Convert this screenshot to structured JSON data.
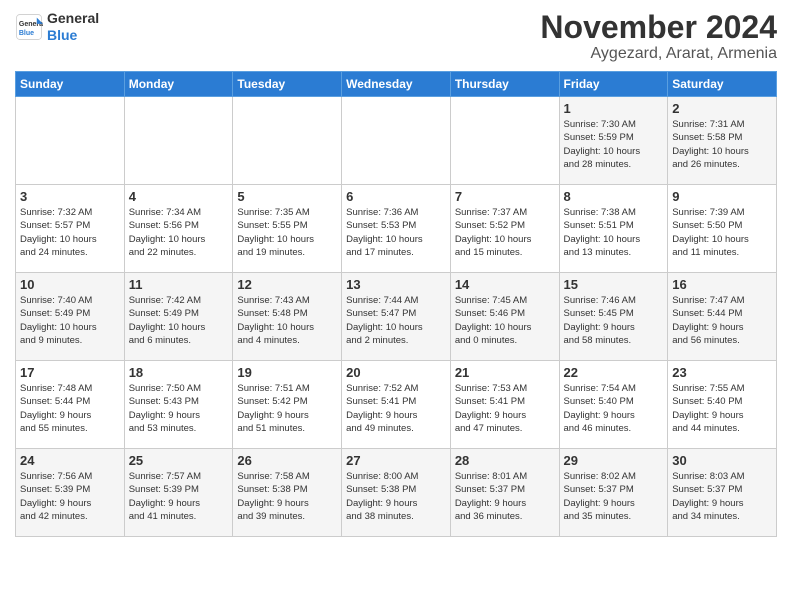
{
  "logo": {
    "line1": "General",
    "line2": "Blue"
  },
  "title": "November 2024",
  "location": "Aygezard, Ararat, Armenia",
  "headers": [
    "Sunday",
    "Monday",
    "Tuesday",
    "Wednesday",
    "Thursday",
    "Friday",
    "Saturday"
  ],
  "weeks": [
    [
      {
        "day": "",
        "info": ""
      },
      {
        "day": "",
        "info": ""
      },
      {
        "day": "",
        "info": ""
      },
      {
        "day": "",
        "info": ""
      },
      {
        "day": "",
        "info": ""
      },
      {
        "day": "1",
        "info": "Sunrise: 7:30 AM\nSunset: 5:59 PM\nDaylight: 10 hours\nand 28 minutes."
      },
      {
        "day": "2",
        "info": "Sunrise: 7:31 AM\nSunset: 5:58 PM\nDaylight: 10 hours\nand 26 minutes."
      }
    ],
    [
      {
        "day": "3",
        "info": "Sunrise: 7:32 AM\nSunset: 5:57 PM\nDaylight: 10 hours\nand 24 minutes."
      },
      {
        "day": "4",
        "info": "Sunrise: 7:34 AM\nSunset: 5:56 PM\nDaylight: 10 hours\nand 22 minutes."
      },
      {
        "day": "5",
        "info": "Sunrise: 7:35 AM\nSunset: 5:55 PM\nDaylight: 10 hours\nand 19 minutes."
      },
      {
        "day": "6",
        "info": "Sunrise: 7:36 AM\nSunset: 5:53 PM\nDaylight: 10 hours\nand 17 minutes."
      },
      {
        "day": "7",
        "info": "Sunrise: 7:37 AM\nSunset: 5:52 PM\nDaylight: 10 hours\nand 15 minutes."
      },
      {
        "day": "8",
        "info": "Sunrise: 7:38 AM\nSunset: 5:51 PM\nDaylight: 10 hours\nand 13 minutes."
      },
      {
        "day": "9",
        "info": "Sunrise: 7:39 AM\nSunset: 5:50 PM\nDaylight: 10 hours\nand 11 minutes."
      }
    ],
    [
      {
        "day": "10",
        "info": "Sunrise: 7:40 AM\nSunset: 5:49 PM\nDaylight: 10 hours\nand 9 minutes."
      },
      {
        "day": "11",
        "info": "Sunrise: 7:42 AM\nSunset: 5:49 PM\nDaylight: 10 hours\nand 6 minutes."
      },
      {
        "day": "12",
        "info": "Sunrise: 7:43 AM\nSunset: 5:48 PM\nDaylight: 10 hours\nand 4 minutes."
      },
      {
        "day": "13",
        "info": "Sunrise: 7:44 AM\nSunset: 5:47 PM\nDaylight: 10 hours\nand 2 minutes."
      },
      {
        "day": "14",
        "info": "Sunrise: 7:45 AM\nSunset: 5:46 PM\nDaylight: 10 hours\nand 0 minutes."
      },
      {
        "day": "15",
        "info": "Sunrise: 7:46 AM\nSunset: 5:45 PM\nDaylight: 9 hours\nand 58 minutes."
      },
      {
        "day": "16",
        "info": "Sunrise: 7:47 AM\nSunset: 5:44 PM\nDaylight: 9 hours\nand 56 minutes."
      }
    ],
    [
      {
        "day": "17",
        "info": "Sunrise: 7:48 AM\nSunset: 5:44 PM\nDaylight: 9 hours\nand 55 minutes."
      },
      {
        "day": "18",
        "info": "Sunrise: 7:50 AM\nSunset: 5:43 PM\nDaylight: 9 hours\nand 53 minutes."
      },
      {
        "day": "19",
        "info": "Sunrise: 7:51 AM\nSunset: 5:42 PM\nDaylight: 9 hours\nand 51 minutes."
      },
      {
        "day": "20",
        "info": "Sunrise: 7:52 AM\nSunset: 5:41 PM\nDaylight: 9 hours\nand 49 minutes."
      },
      {
        "day": "21",
        "info": "Sunrise: 7:53 AM\nSunset: 5:41 PM\nDaylight: 9 hours\nand 47 minutes."
      },
      {
        "day": "22",
        "info": "Sunrise: 7:54 AM\nSunset: 5:40 PM\nDaylight: 9 hours\nand 46 minutes."
      },
      {
        "day": "23",
        "info": "Sunrise: 7:55 AM\nSunset: 5:40 PM\nDaylight: 9 hours\nand 44 minutes."
      }
    ],
    [
      {
        "day": "24",
        "info": "Sunrise: 7:56 AM\nSunset: 5:39 PM\nDaylight: 9 hours\nand 42 minutes."
      },
      {
        "day": "25",
        "info": "Sunrise: 7:57 AM\nSunset: 5:39 PM\nDaylight: 9 hours\nand 41 minutes."
      },
      {
        "day": "26",
        "info": "Sunrise: 7:58 AM\nSunset: 5:38 PM\nDaylight: 9 hours\nand 39 minutes."
      },
      {
        "day": "27",
        "info": "Sunrise: 8:00 AM\nSunset: 5:38 PM\nDaylight: 9 hours\nand 38 minutes."
      },
      {
        "day": "28",
        "info": "Sunrise: 8:01 AM\nSunset: 5:37 PM\nDaylight: 9 hours\nand 36 minutes."
      },
      {
        "day": "29",
        "info": "Sunrise: 8:02 AM\nSunset: 5:37 PM\nDaylight: 9 hours\nand 35 minutes."
      },
      {
        "day": "30",
        "info": "Sunrise: 8:03 AM\nSunset: 5:37 PM\nDaylight: 9 hours\nand 34 minutes."
      }
    ]
  ]
}
